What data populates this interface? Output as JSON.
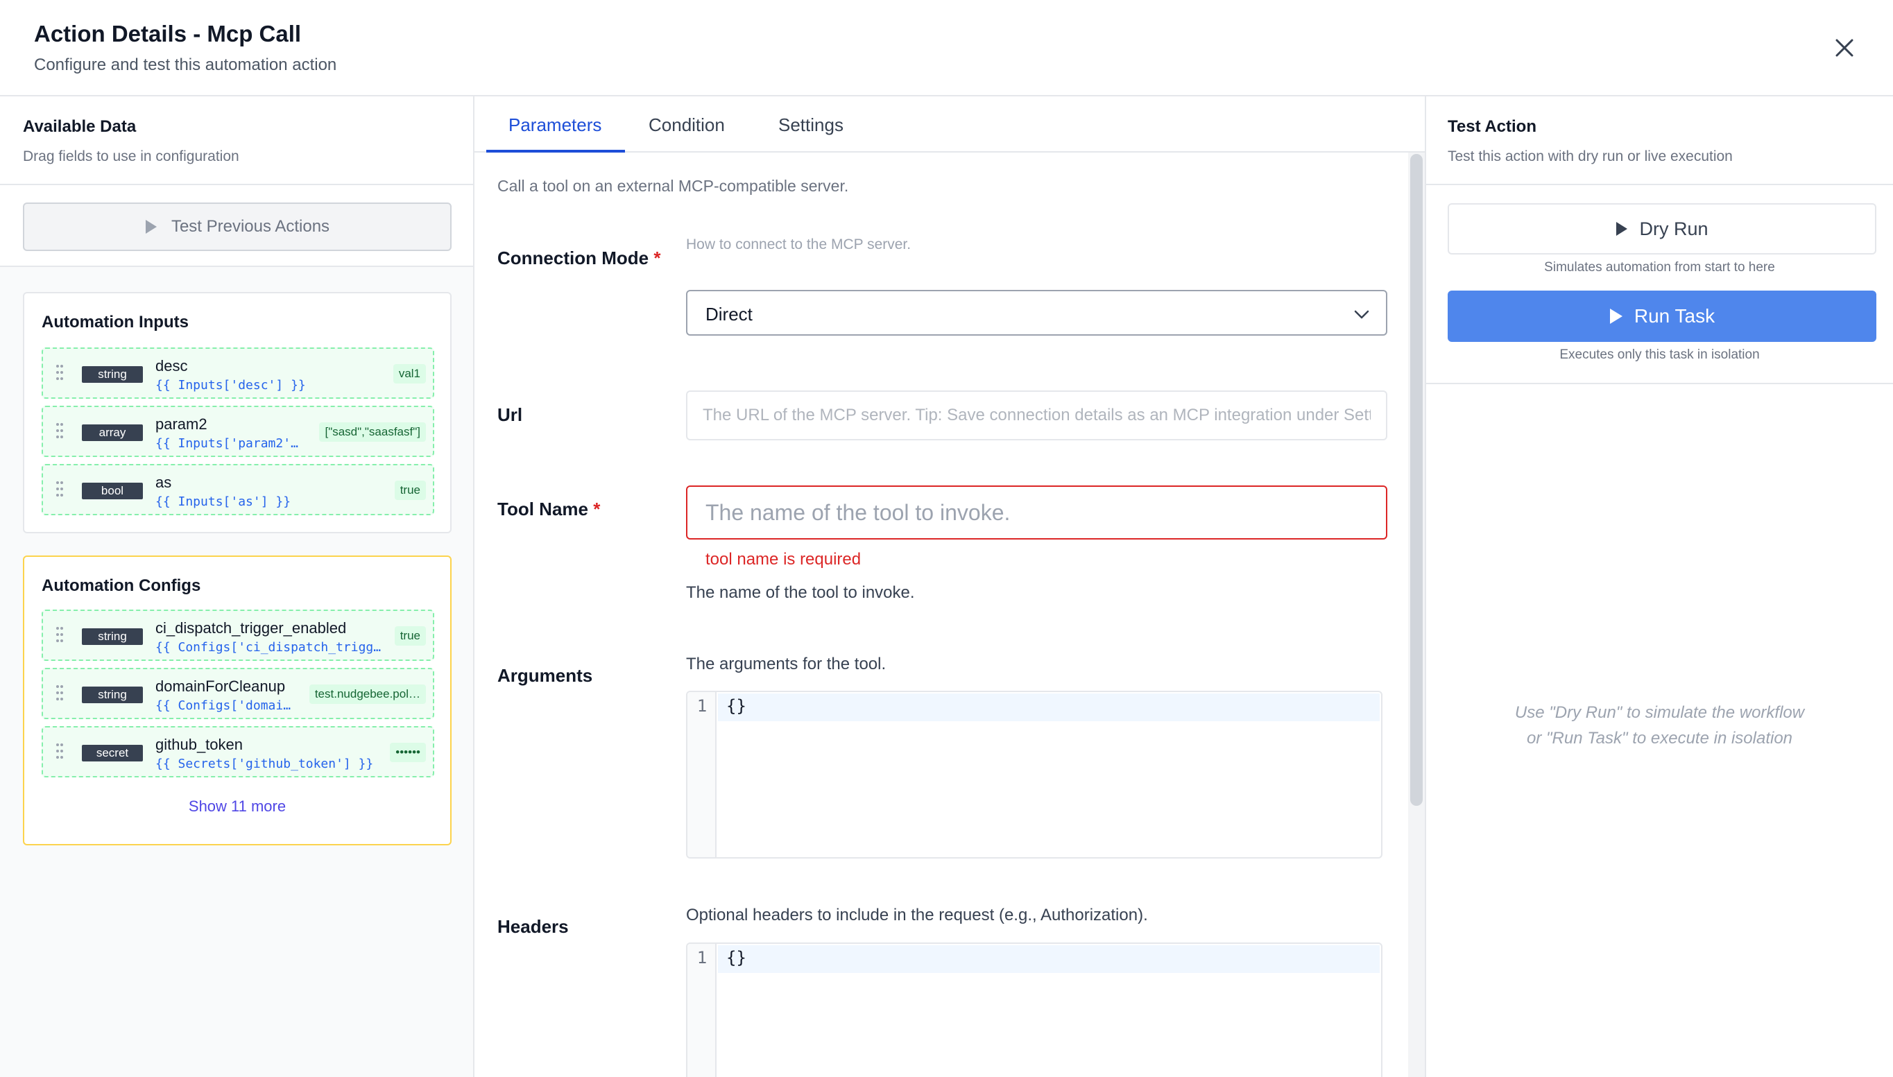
{
  "header": {
    "title": "Action Details - Mcp Call",
    "subtitle": "Configure and test this automation action"
  },
  "available_data": {
    "title": "Available Data",
    "subtitle": "Drag fields to use in configuration",
    "test_previous_label": "Test Previous Actions",
    "inputs": {
      "title": "Automation Inputs",
      "fields": [
        {
          "type": "string",
          "name": "desc",
          "expr": "{{ Inputs['desc'] }}",
          "value": "val1"
        },
        {
          "type": "array",
          "name": "param2",
          "expr": "{{ Inputs['param2'…",
          "value": "[\"sasd\",\"saasfasf\"]"
        },
        {
          "type": "bool",
          "name": "as",
          "expr": "{{ Inputs['as'] }}",
          "value": "true"
        }
      ]
    },
    "configs": {
      "title": "Automation Configs",
      "fields": [
        {
          "type": "string",
          "name": "ci_dispatch_trigger_enabled",
          "expr": "{{ Configs['ci_dispatch_trigg…",
          "value": "true"
        },
        {
          "type": "string",
          "name": "domainForCleanup",
          "expr": "{{ Configs['domai…",
          "value": "test.nudgebee.pol…"
        },
        {
          "type": "secret",
          "name": "github_token",
          "expr": "{{ Secrets['github_token'] }}",
          "value": "••••••"
        }
      ],
      "show_more_label": "Show 11 more"
    }
  },
  "tabs": [
    {
      "label": "Parameters",
      "active": true
    },
    {
      "label": "Condition",
      "active": false
    },
    {
      "label": "Settings",
      "active": false
    }
  ],
  "parameters": {
    "description": "Call a tool on an external MCP-compatible server.",
    "connection_mode": {
      "label": "Connection Mode",
      "required_mark": "*",
      "hint": "How to connect to the MCP server.",
      "value": "Direct"
    },
    "url": {
      "label": "Url",
      "placeholder": "The URL of the MCP server. Tip: Save connection details as an MCP integration under Settings"
    },
    "tool_name": {
      "label": "Tool Name",
      "required_mark": "*",
      "placeholder": "The name of the tool to invoke.",
      "error": "tool name is required",
      "help": "The name of the tool to invoke."
    },
    "arguments": {
      "label": "Arguments",
      "help": "The arguments for the tool.",
      "line_number": "1",
      "code": "{}"
    },
    "headers": {
      "label": "Headers",
      "help": "Optional headers to include in the request (e.g., Authorization).",
      "line_number": "1",
      "code": "{}"
    }
  },
  "test_action": {
    "title": "Test Action",
    "subtitle": "Test this action with dry run or live execution",
    "dry_run_label": "Dry Run",
    "dry_run_caption": "Simulates automation from start to here",
    "run_task_label": "Run Task",
    "run_task_caption": "Executes only this task in isolation",
    "empty_line1": "Use \"Dry Run\" to simulate the workflow",
    "empty_line2": "or \"Run Task\" to execute in isolation"
  },
  "colors": {
    "accent": "#1d4ed8",
    "primary_button": "#4f86ec",
    "error": "#dc2626",
    "input_card_bg": "#f0fdf4",
    "config_card_border": "#fcd34d"
  }
}
